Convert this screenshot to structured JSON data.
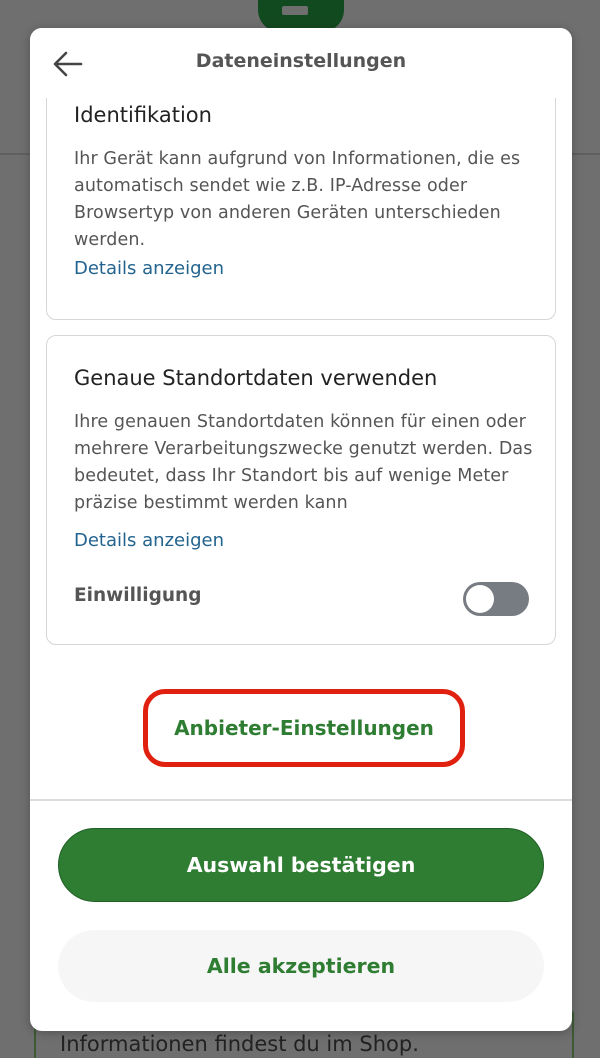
{
  "background": {
    "partial_text": "Informationen findest du im Shop."
  },
  "modal": {
    "title": "Dateneinstellungen",
    "back_icon": "arrow-left-icon"
  },
  "cards": [
    {
      "title": "Identifikation",
      "description": "Ihr Gerät kann aufgrund von Informationen, die es automatisch sendet wie z.B. IP-Adresse oder Browsertyp von anderen Geräten unterschieden werden.",
      "details_link": "Details anzeigen"
    },
    {
      "title": "Genaue Standortdaten verwenden",
      "description": "Ihre genauen Standortdaten können für einen oder mehrere Verarbeitungszwecke genutzt werden. Das bedeutet, dass Ihr Standort bis auf wenige Meter präzise bestimmt werden kann",
      "details_link": "Details anzeigen",
      "consent_label": "Einwilligung",
      "consent_on": false
    }
  ],
  "buttons": {
    "vendor_settings": "Anbieter-Einstellungen",
    "confirm_selection": "Auswahl bestätigen",
    "accept_all": "Alle akzeptieren"
  },
  "colors": {
    "brand_green": "#2e7d32",
    "link_blue": "#23638f",
    "highlight_red": "#e0210f"
  }
}
